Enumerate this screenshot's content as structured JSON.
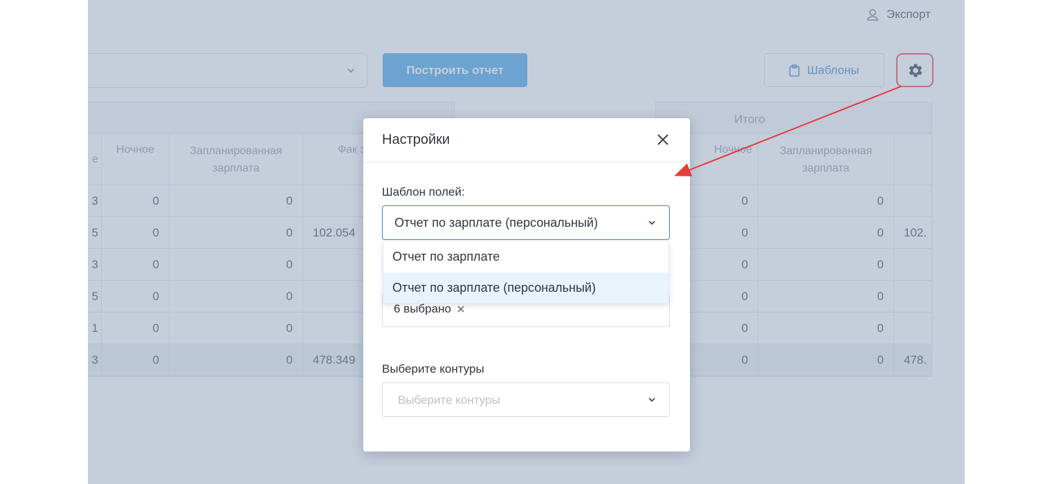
{
  "header": {
    "export_label": "Экспорт"
  },
  "toolbar": {
    "build_button": "Построить отчет",
    "templates_button": "Шаблоны"
  },
  "left_table": {
    "headers": [
      "е",
      "Ночное",
      "Запланированная зарплата",
      "Фак за"
    ],
    "rows": [
      [
        "3",
        "0",
        "0",
        ""
      ],
      [
        "5",
        "0",
        "0",
        "102.054"
      ],
      [
        "3",
        "0",
        "0",
        ""
      ],
      [
        "5",
        "0",
        "0",
        ""
      ],
      [
        "1",
        "0",
        "0",
        ""
      ],
      [
        "3",
        "0",
        "0",
        "478.349"
      ]
    ]
  },
  "right_table": {
    "group_title": "Итого",
    "headers": [
      "Ночное",
      "Запланированная зарплата",
      ""
    ],
    "rows": [
      [
        "0",
        "0",
        ""
      ],
      [
        "0",
        "0",
        "102."
      ],
      [
        "0",
        "0",
        ""
      ],
      [
        "0",
        "0",
        ""
      ],
      [
        "0",
        "0",
        ""
      ],
      [
        "0",
        "0",
        "478."
      ]
    ]
  },
  "modal": {
    "title": "Настройки",
    "template_label": "Шаблон полей:",
    "template_value": "Отчет по зарплате (персональный)",
    "options": [
      "Отчет по зарплате",
      "Отчет по зарплате (персональный)"
    ],
    "selected_tag": "6 выбрано",
    "contours_label": "Выберите контуры",
    "contours_placeholder": "Выберите контуры"
  },
  "colors": {
    "primary": "#3c9fe8",
    "accent_link": "#2f7cd0",
    "annotation": "#e53b3b",
    "overlay": "#96a6be"
  },
  "icons": {
    "export": "export-icon",
    "templates": "clipboard-icon",
    "settings": "gear-icon",
    "close": "close-icon",
    "dropdown": "chevron-down-icon",
    "tag_remove": "x-icon"
  }
}
